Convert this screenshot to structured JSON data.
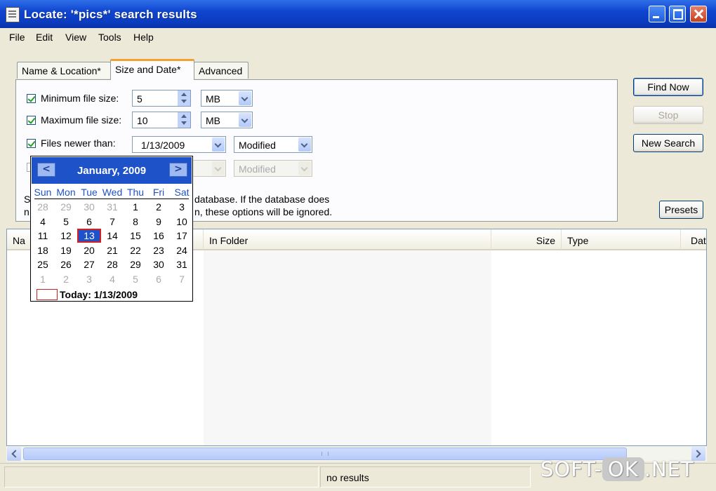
{
  "window": {
    "title": "Locate: '*pics*' search results"
  },
  "menu": [
    "File",
    "Edit",
    "View",
    "Tools",
    "Help"
  ],
  "tabs": [
    "Name & Location*",
    "Size and Date*",
    "Advanced"
  ],
  "size_date": {
    "min_label": "Minimum file size:",
    "min_value": "5",
    "min_unit": "MB",
    "max_label": "Maximum file size:",
    "max_value": "10",
    "max_unit": "MB",
    "newer_label": "Files newer than:",
    "newer_date": "1/13/2009",
    "newer_type": "Modified",
    "older_type": "Modified",
    "note_line1_start": "S",
    "note_line1_end": "database. If the database does",
    "note_line2_start": "n",
    "note_line2_end": "n, these options will be ignored."
  },
  "buttons": {
    "find_now": "Find Now",
    "stop": "Stop",
    "new_search": "New Search",
    "presets": "Presets"
  },
  "calendar": {
    "title": "January, 2009",
    "prev": "<",
    "next": ">",
    "weekdays": [
      "Sun",
      "Mon",
      "Tue",
      "Wed",
      "Thu",
      "Fri",
      "Sat"
    ],
    "weeks": [
      [
        "28",
        "29",
        "30",
        "31",
        "1",
        "2",
        "3"
      ],
      [
        "4",
        "5",
        "6",
        "7",
        "8",
        "9",
        "10"
      ],
      [
        "11",
        "12",
        "13",
        "14",
        "15",
        "16",
        "17"
      ],
      [
        "18",
        "19",
        "20",
        "21",
        "22",
        "23",
        "24"
      ],
      [
        "25",
        "26",
        "27",
        "28",
        "29",
        "30",
        "31"
      ],
      [
        "1",
        "2",
        "3",
        "4",
        "5",
        "6",
        "7"
      ]
    ],
    "selected_day": "13",
    "today_text": "Today: 1/13/2009"
  },
  "results": {
    "columns": [
      "Na",
      "In Folder",
      "Size",
      "Type",
      "Dat"
    ]
  },
  "status": {
    "text": "no results"
  },
  "watermark": {
    "left": "SOFT-",
    "mid": "OK",
    "right": ".NET"
  }
}
